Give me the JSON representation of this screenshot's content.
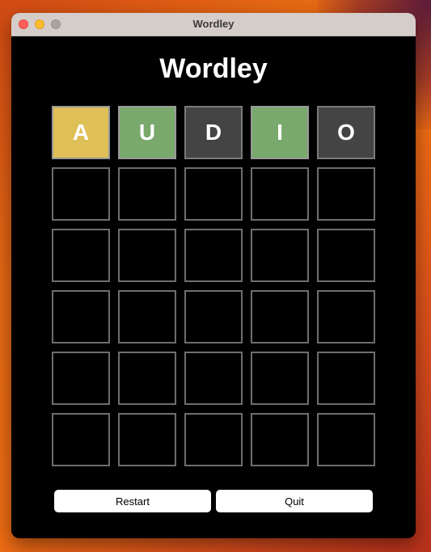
{
  "window": {
    "title": "Wordley"
  },
  "app": {
    "heading": "Wordley"
  },
  "board": {
    "rows": [
      [
        {
          "letter": "A",
          "state": "present"
        },
        {
          "letter": "U",
          "state": "correct"
        },
        {
          "letter": "D",
          "state": "absent"
        },
        {
          "letter": "I",
          "state": "correct"
        },
        {
          "letter": "O",
          "state": "absent"
        }
      ],
      [
        {
          "letter": "",
          "state": "empty"
        },
        {
          "letter": "",
          "state": "empty"
        },
        {
          "letter": "",
          "state": "empty"
        },
        {
          "letter": "",
          "state": "empty"
        },
        {
          "letter": "",
          "state": "empty"
        }
      ],
      [
        {
          "letter": "",
          "state": "empty"
        },
        {
          "letter": "",
          "state": "empty"
        },
        {
          "letter": "",
          "state": "empty"
        },
        {
          "letter": "",
          "state": "empty"
        },
        {
          "letter": "",
          "state": "empty"
        }
      ],
      [
        {
          "letter": "",
          "state": "empty"
        },
        {
          "letter": "",
          "state": "empty"
        },
        {
          "letter": "",
          "state": "empty"
        },
        {
          "letter": "",
          "state": "empty"
        },
        {
          "letter": "",
          "state": "empty"
        }
      ],
      [
        {
          "letter": "",
          "state": "empty"
        },
        {
          "letter": "",
          "state": "empty"
        },
        {
          "letter": "",
          "state": "empty"
        },
        {
          "letter": "",
          "state": "empty"
        },
        {
          "letter": "",
          "state": "empty"
        }
      ],
      [
        {
          "letter": "",
          "state": "empty"
        },
        {
          "letter": "",
          "state": "empty"
        },
        {
          "letter": "",
          "state": "empty"
        },
        {
          "letter": "",
          "state": "empty"
        },
        {
          "letter": "",
          "state": "empty"
        }
      ]
    ]
  },
  "buttons": {
    "restart": "Restart",
    "quit": "Quit"
  },
  "colors": {
    "present": "#dfc058",
    "correct": "#79a96c",
    "absent": "#444444",
    "empty": "#000000"
  }
}
